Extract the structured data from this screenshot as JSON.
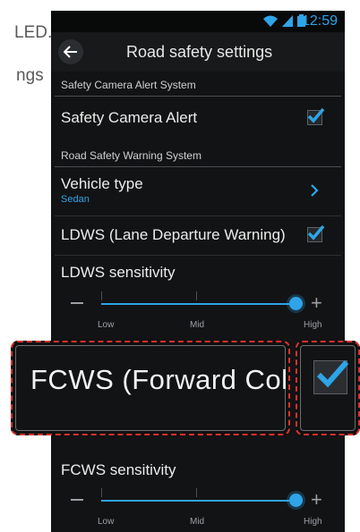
{
  "doc": {
    "text1": "LED.",
    "text2": "ngs"
  },
  "status": {
    "time": "12:59"
  },
  "header": {
    "title": "Road safety settings"
  },
  "sections": {
    "camera_header": "Safety Camera Alert System",
    "warning_header": "Road Safety Warning System"
  },
  "items": {
    "safety_camera": {
      "label": "Safety Camera Alert",
      "checked": true
    },
    "vehicle_type": {
      "label": "Vehicle type",
      "value": "Sedan"
    },
    "ldws": {
      "label": "LDWS (Lane Departure Warning)",
      "checked": true
    },
    "ldws_sensitivity": {
      "label": "LDWS sensitivity",
      "low": "Low",
      "mid": "Mid",
      "high": "High",
      "level": "High"
    },
    "fcws": {
      "label": "FCWS (Forward Coll",
      "checked": true
    },
    "fcws_sensitivity": {
      "label": "FCWS sensitivity",
      "low": "Low",
      "mid": "Mid",
      "high": "High",
      "level": "High"
    }
  },
  "colors": {
    "accent": "#2fa4e7",
    "callout": "#e0302c",
    "background": "#121314"
  }
}
